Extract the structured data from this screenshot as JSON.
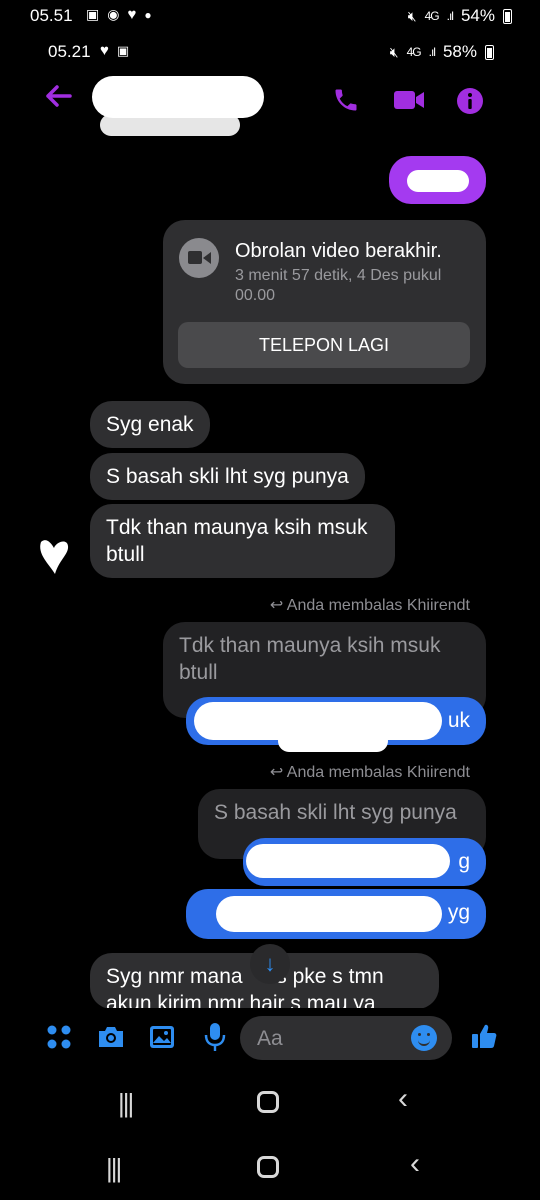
{
  "status_outer": {
    "time": "05.51",
    "battery": "54%",
    "network": "4G"
  },
  "status_inner": {
    "time": "05.21",
    "battery": "58%",
    "network": "4G"
  },
  "colors": {
    "accent_purple": "#a12ee0",
    "sent_bubble": "#a43af0",
    "blue_bubble": "#2e6ee8",
    "messenger_blue": "#2e8df0"
  },
  "header": {
    "back_icon": "arrow-left-icon",
    "call_icon": "phone-icon",
    "video_icon": "video-icon",
    "info_icon": "info-icon"
  },
  "call_card": {
    "title": "Obrolan video berakhir.",
    "subtitle": "3 menit 57 detik, 4 Des pukul 00.00",
    "button": "TELEPON LAGI"
  },
  "messages": {
    "m1": "Syg enak",
    "m2": "S basah skli lht syg punya",
    "m3": "Tdk than maunya ksih msuk btull",
    "reply1_note": "Anda membalas Khiirendt",
    "reply1_quote": "Tdk than maunya ksih msuk btull",
    "reply1_visible": "uk",
    "reply2_note": "Anda membalas Khiirendt",
    "reply2_quote": "S basah skli lht syg punya",
    "reply2_visible": "g",
    "reply3_visible": "yg",
    "m_last": "Syg nmr mana",
    "m_last_tail": "s pke s tmn",
    "m_last_line2": "akun kirim nmr hair s mau ya"
  },
  "composer": {
    "placeholder": "Aa"
  }
}
